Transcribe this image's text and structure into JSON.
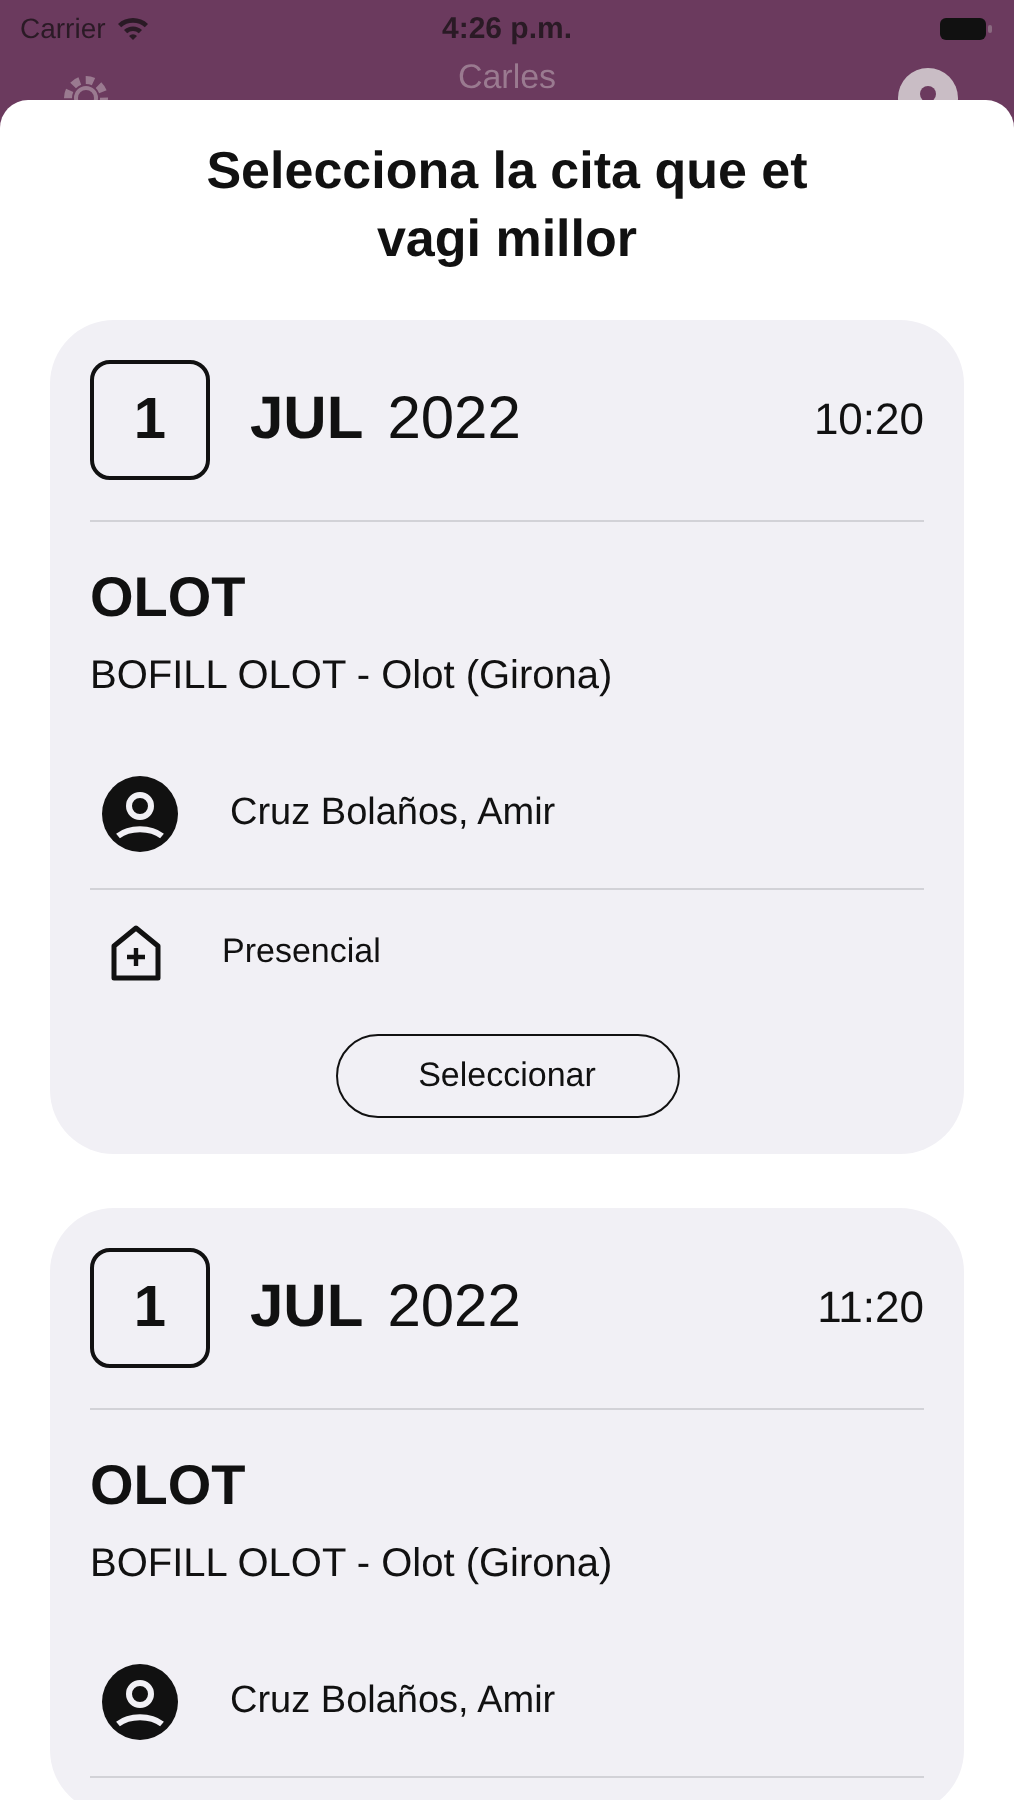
{
  "status_bar": {
    "carrier": "Carrier",
    "time": "4:26 p.m."
  },
  "nav_bar": {
    "title": "Carles"
  },
  "sheet": {
    "title": "Selecciona la cita que et vagi millor"
  },
  "appointments": [
    {
      "day": "1",
      "month": "JUL",
      "year": "2022",
      "time": "10:20",
      "city": "OLOT",
      "center": "BOFILL OLOT -  Olot (Girona)",
      "professional": "Cruz Bolaños, Amir",
      "mode": "Presencial",
      "action": "Seleccionar"
    },
    {
      "day": "1",
      "month": "JUL",
      "year": "2022",
      "time": "11:20",
      "city": "OLOT",
      "center": "BOFILL OLOT -  Olot (Girona)",
      "professional": "Cruz Bolaños, Amir"
    }
  ]
}
